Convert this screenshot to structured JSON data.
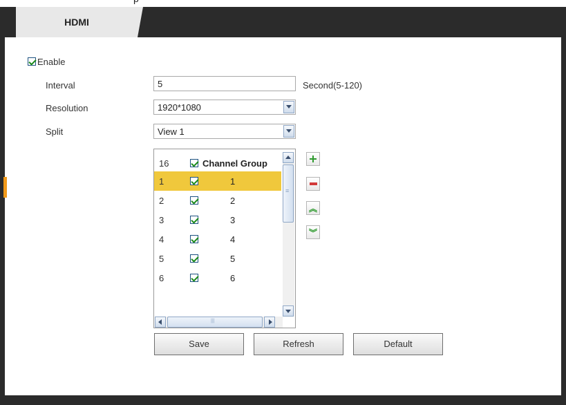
{
  "top_strip": {
    "text": "p"
  },
  "tabs": [
    {
      "label": "HDMI"
    }
  ],
  "form": {
    "enable": {
      "label": "Enable",
      "checked": true
    },
    "interval": {
      "label": "Interval",
      "value": "5",
      "unit": "Second(5-120)"
    },
    "resolution": {
      "label": "Resolution",
      "value": "1920*1080"
    },
    "split": {
      "label": "Split",
      "value": "View 1"
    }
  },
  "channel_list": {
    "header": {
      "count": "16",
      "checked": true,
      "label": "Channel Group"
    },
    "rows": [
      {
        "index": "1",
        "checked": true,
        "group": "1",
        "selected": true
      },
      {
        "index": "2",
        "checked": true,
        "group": "2",
        "selected": false
      },
      {
        "index": "3",
        "checked": true,
        "group": "3",
        "selected": false
      },
      {
        "index": "4",
        "checked": true,
        "group": "4",
        "selected": false
      },
      {
        "index": "5",
        "checked": true,
        "group": "5",
        "selected": false
      },
      {
        "index": "6",
        "checked": true,
        "group": "6",
        "selected": false
      }
    ]
  },
  "list_actions": {
    "add_icon": "plus-icon",
    "remove_icon": "minus-icon",
    "move_up_icon": "double-chevron-up-icon",
    "move_down_icon": "double-chevron-down-icon"
  },
  "buttons": {
    "save": "Save",
    "refresh": "Refresh",
    "default": "Default"
  },
  "colors": {
    "frame": "#2b2b2b",
    "tab": "#e8e8e8",
    "selected_row": "#f0c83c",
    "accent": "#f29a1a",
    "check": "#1a8a1a"
  }
}
